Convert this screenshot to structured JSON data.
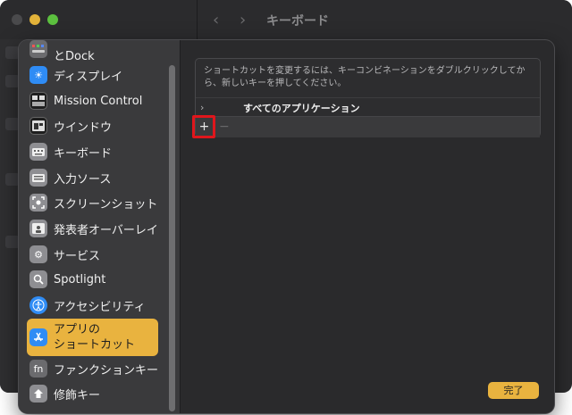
{
  "window": {
    "title": "キーボード",
    "nav_back": "‹",
    "nav_forward": "›"
  },
  "sidebar": {
    "items": [
      {
        "id": "dock",
        "label": "とDock",
        "icon": "dock-icon",
        "icon_color": "#6b6b6e"
      },
      {
        "id": "display",
        "label": "ディスプレイ",
        "icon": "sun-icon",
        "icon_color": "#2f8cf5"
      },
      {
        "id": "mission",
        "label": "Mission Control",
        "icon": "mission-control-icon",
        "icon_color": "#1f1f1f"
      },
      {
        "id": "window",
        "label": "ウインドウ",
        "icon": "window-icon",
        "icon_color": "#1f1f1f"
      },
      {
        "id": "keyboard",
        "label": "キーボード",
        "icon": "keyboard-icon",
        "icon_color": "#8e8e92"
      },
      {
        "id": "input",
        "label": "入力ソース",
        "icon": "input-source-icon",
        "icon_color": "#8e8e92"
      },
      {
        "id": "screenshot",
        "label": "スクリーンショット",
        "icon": "screenshot-icon",
        "icon_color": "#8e8e92"
      },
      {
        "id": "presenter",
        "label": "発表者オーバーレイ",
        "icon": "presenter-icon",
        "icon_color": "#8e8e92"
      },
      {
        "id": "services",
        "label": "サービス",
        "icon": "gears-icon",
        "icon_color": "#8e8e92"
      },
      {
        "id": "spotlight",
        "label": "Spotlight",
        "icon": "magnifier-icon",
        "icon_color": "#8e8e92"
      },
      {
        "id": "accessibility",
        "label": "アクセシビリティ",
        "icon": "accessibility-icon",
        "icon_color": "#2f8cf5"
      },
      {
        "id": "appshortcuts",
        "label": "アプリの\nショートカット",
        "label1": "アプリの",
        "label2": "ショートカット",
        "icon": "app-store-icon",
        "icon_color": "#2f8cf5",
        "selected": true
      },
      {
        "id": "fn",
        "label": "ファンクションキー",
        "icon": "fn-icon",
        "icon_color": "#6b6b6e",
        "icon_text": "fn"
      },
      {
        "id": "modifier",
        "label": "修飾キー",
        "icon": "modifier-key-icon",
        "icon_color": "#8e8e92"
      }
    ]
  },
  "panel": {
    "description": "ショートカットを変更するには、キーコンビネーションをダブルクリックしてから、新しいキーを押してください。",
    "row_label": "すべてのアプリケーション",
    "chevron": "›",
    "plus": "+",
    "minus": "−"
  },
  "footer": {
    "done_label": "完了"
  },
  "colors": {
    "accent": "#e9b33f",
    "highlight": "#e0161c"
  }
}
